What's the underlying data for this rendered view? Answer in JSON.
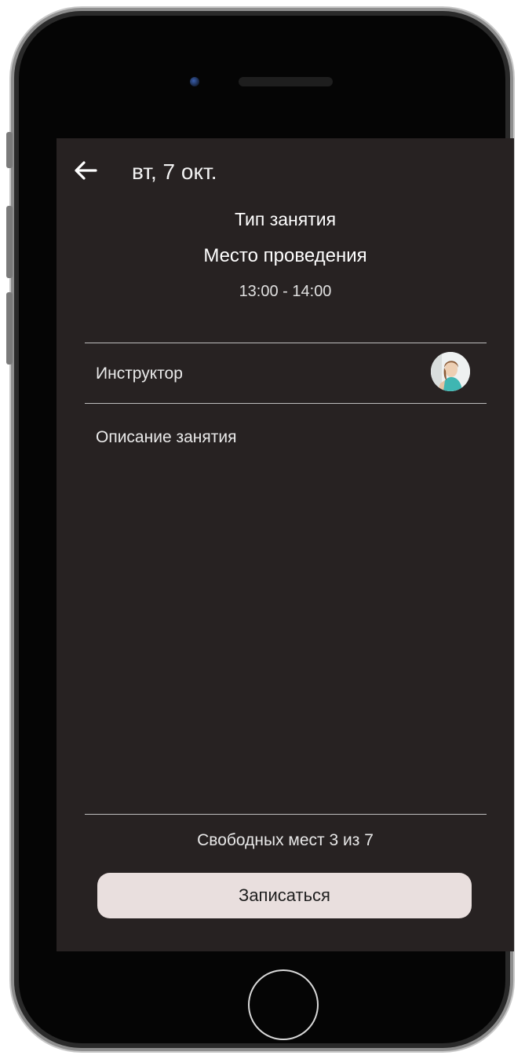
{
  "header": {
    "back_icon": "arrow-left-icon",
    "date": "вт, 7 окт."
  },
  "session": {
    "class_type": "Тип занятия",
    "location": "Место проведения",
    "time": "13:00 - 14:00"
  },
  "instructor": {
    "label": "Инструктор",
    "avatar_icon": "instructor-avatar"
  },
  "description": {
    "label": "Описание занятия"
  },
  "footer": {
    "seats_text": "Свободных мест 3 из 7",
    "signup_label": "Записаться"
  },
  "colors": {
    "screen_bg": "#272222",
    "button_bg": "#e9dfde",
    "text": "#ffffff"
  }
}
